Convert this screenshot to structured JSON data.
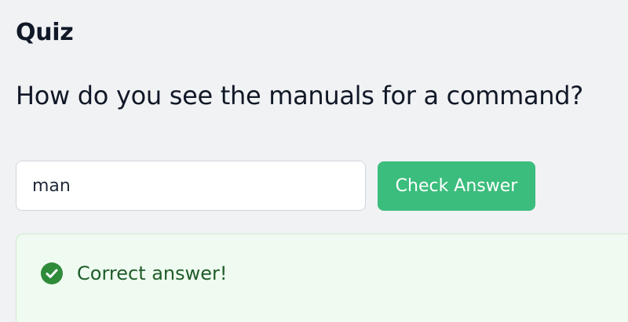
{
  "quiz": {
    "title": "Quiz",
    "question": "How do you see the manuals for a command?"
  },
  "answer": {
    "value": "man"
  },
  "actions": {
    "check_label": "Check Answer"
  },
  "result": {
    "icon": "check-circle-icon",
    "message": "Correct answer!"
  },
  "colors": {
    "background": "#f1f2f4",
    "button": "#3bbd7d",
    "success_bg": "#effaf0",
    "success_text": "#1f5d2a",
    "success_icon": "#2e8b3a"
  }
}
